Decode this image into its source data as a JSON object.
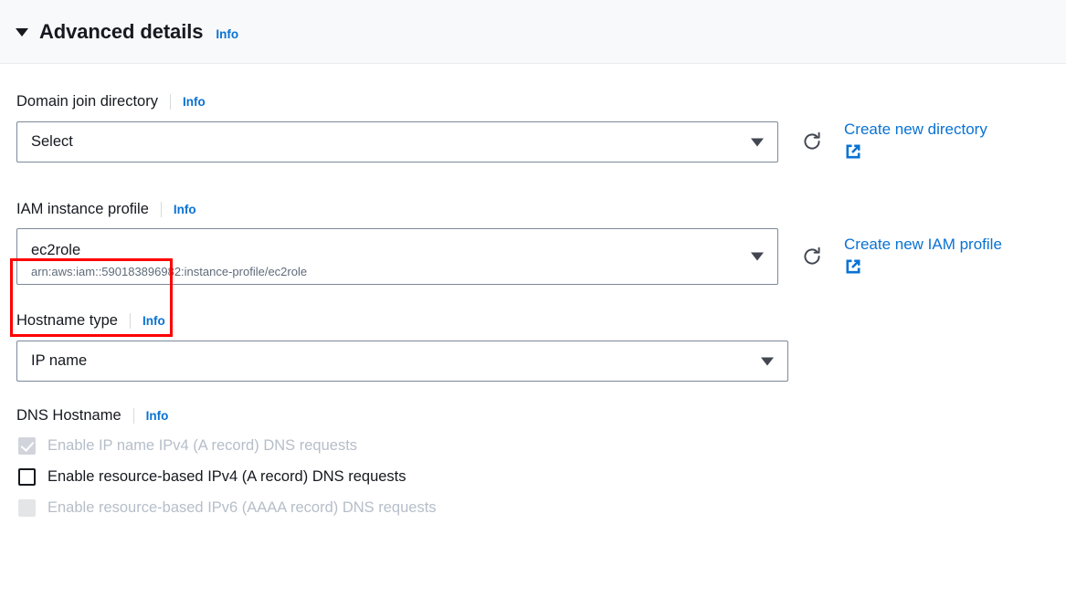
{
  "section": {
    "title": "Advanced details",
    "info_label": "Info",
    "caret_icon": "caret-down-icon",
    "expanded": true
  },
  "fields": {
    "domain_join_directory": {
      "label": "Domain join directory",
      "info_label": "Info",
      "select_value": "Select",
      "refresh_icon": "refresh-icon",
      "create_link": "Create new directory",
      "external_icon": "external-link-icon"
    },
    "iam_instance_profile": {
      "label": "IAM instance profile",
      "info_label": "Info",
      "select_value": "ec2role",
      "select_subtext": "arn:aws:iam::590183896982:instance-profile/ec2role",
      "refresh_icon": "refresh-icon",
      "create_link": "Create new IAM profile",
      "external_icon": "external-link-icon",
      "highlighted": true
    },
    "hostname_type": {
      "label": "Hostname type",
      "info_label": "Info",
      "select_value": "IP name"
    },
    "dns_hostname": {
      "label": "DNS Hostname",
      "info_label": "Info",
      "options": [
        {
          "label": "Enable IP name IPv4 (A record) DNS requests",
          "checked": true,
          "disabled": true
        },
        {
          "label": "Enable resource-based IPv4 (A record) DNS requests",
          "checked": false,
          "disabled": false
        },
        {
          "label": "Enable resource-based IPv6 (AAAA record) DNS requests",
          "checked": false,
          "disabled": true
        }
      ]
    }
  },
  "colors": {
    "link_blue": "#0972d3",
    "annotation_red": "#ff0000",
    "header_bg": "#f8f9fa",
    "border_gray": "#7d8998",
    "muted_text": "#b6bec9",
    "sub_text": "#5f6b7a"
  }
}
